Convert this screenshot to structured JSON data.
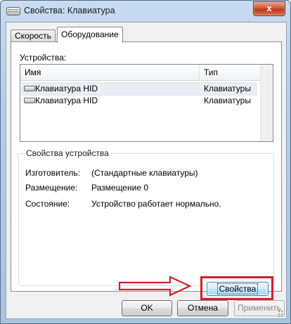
{
  "window": {
    "title": "Свойства: Клавиатура",
    "close_label": "x"
  },
  "tabs": [
    {
      "label": "Скорость",
      "active": false
    },
    {
      "label": "Оборудование",
      "active": true
    }
  ],
  "devices": {
    "label": "Устройства:",
    "columns": [
      "Имя",
      "Тип"
    ],
    "rows": [
      {
        "name": "Клавиатура HID",
        "type": "Клавиатуры",
        "selected": true,
        "icon": "keyboard-icon"
      },
      {
        "name": "Клавиатура HID",
        "type": "Клавиатуры",
        "selected": false,
        "icon": "keyboard-icon"
      }
    ]
  },
  "device_properties": {
    "title": "Свойства устройства",
    "manufacturer": {
      "label": "Изготовитель:",
      "value": "(Стандартные клавиатуры)"
    },
    "location": {
      "label": "Размещение:",
      "value": "Размещение 0"
    },
    "status": {
      "label": "Состояние:",
      "value": "Устройство работает нормально."
    },
    "properties_button": "Свойства"
  },
  "footer": {
    "ok": "OK",
    "cancel": "Отмена",
    "apply": "Применить"
  },
  "colors": {
    "highlight": "#d21f2d",
    "accent": "#3c7fb1"
  }
}
